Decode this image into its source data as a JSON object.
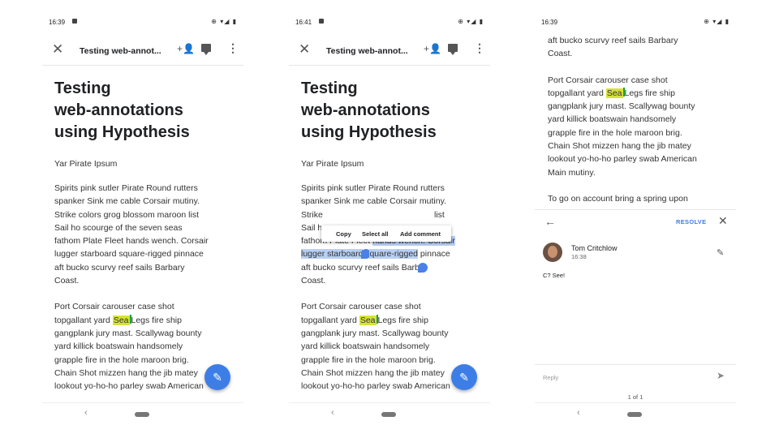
{
  "panels": [
    {
      "status": {
        "time": "16:39",
        "icons": "⊕ ▾◢ ▮"
      },
      "toolbar": {
        "title": "Testing web-annot..."
      },
      "heading": [
        "Testing",
        "web-annotations",
        "using Hypothesis"
      ],
      "subtitle": "Yar Pirate Ipsum",
      "para1": [
        "Spirits pink sutler Pirate Round rutters",
        "spanker Sink me cable Corsair mutiny.",
        "Strike colors grog blossom maroon list",
        "Sail ho scourge of the seven seas",
        "fathom Plate Fleet hands wench. Corsair",
        "lugger starboard square-rigged pinnace",
        "aft bucko scurvy reef sails Barbary",
        "Coast."
      ],
      "para2": {
        "l1": "Port Corsair carouser case shot",
        "l2a": "topgallant yard ",
        "l2hl": "Sea",
        "l2b": "Legs fire ship",
        "l3": "gangplank jury mast. Scallywag bounty",
        "l4": "yard killick boatswain handsomely",
        "l5": "grapple fire in the hole maroon brig.",
        "l6": "Chain Shot mizzen hang the jib matey",
        "l7": "lookout yo-ho-ho parley swab American"
      }
    },
    {
      "status": {
        "time": "16:41",
        "icons": "⊕ ▾◢ ▮"
      },
      "toolbar": {
        "title": "Testing web-annot..."
      },
      "popup": {
        "copy": "Copy",
        "select_all": "Select all",
        "add_comment": "Add comment"
      },
      "para1": {
        "l1": "Spirits pink sutler Pirate Round rutters",
        "l2": "spanker Sink me cable Corsair mutiny.",
        "l3a": "Strike",
        "l3b": "list",
        "l4a": "Sail hc",
        "l5a": "fathom Plate Fleet ",
        "l5sel": "hands wench. Corsair",
        "l6sel": "lugger starboard",
        "l6sel2": "quare-rigged",
        "l6b": " pinnace",
        "l7a": "aft bucko scurvy reef sails Barb",
        "l8": "Coast."
      }
    },
    {
      "status": {
        "time": "16:39",
        "icons": "⊕ ▾◢ ▮"
      },
      "top_text": [
        "aft bucko scurvy reef sails Barbary",
        "Coast."
      ],
      "para2": {
        "l1": "Port Corsair carouser case shot",
        "l2a": "topgallant yard ",
        "l2hl": "Sea",
        "l2b": "Legs fire ship",
        "l3": "gangplank jury mast. Scallywag bounty",
        "l4": "yard killick boatswain handsomely",
        "l5": "grapple fire in the hole maroon brig.",
        "l6": "Chain Shot mizzen hang the jib matey",
        "l7": "lookout yo-ho-ho parley swab American",
        "l8": "Main mutiny."
      },
      "para3": "To go on account bring a spring upon",
      "sheet": {
        "resolve": "RESOLVE",
        "author": "Tom Critchlow",
        "time": "16:38",
        "comment": "C? See!",
        "reply_placeholder": "Reply",
        "pager": "1 of 1"
      }
    }
  ],
  "nav": {
    "back": "‹"
  },
  "icons": {
    "close": "close-icon",
    "add_person": "add-person-icon",
    "comment": "comment-icon",
    "more": "more-vert-icon",
    "fab": "edit-icon",
    "back_arrow": "arrow-back-icon",
    "send": "send-icon"
  },
  "colors": {
    "highlight": "#d6e337",
    "selection": "#b9cff4",
    "accent": "#3d7ee6"
  }
}
